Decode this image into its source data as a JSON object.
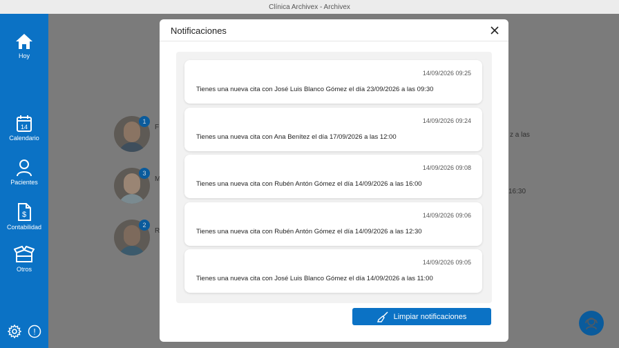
{
  "window": {
    "title": "Clínica Archivex - Archivex"
  },
  "sidebar": {
    "items": [
      {
        "label": "Hoy",
        "icon": "home-icon"
      },
      {
        "label": "Calendario",
        "icon": "calendar-icon",
        "day": "14"
      },
      {
        "label": "Pacientes",
        "icon": "user-icon"
      },
      {
        "label": "Contabilidad",
        "icon": "invoice-icon"
      },
      {
        "label": "Otros",
        "icon": "box-icon"
      }
    ],
    "bottom": [
      {
        "icon": "gear-icon"
      },
      {
        "icon": "info-icon",
        "glyph": "!"
      }
    ]
  },
  "background": {
    "rows": [
      {
        "badge": "1",
        "initial": "F",
        "trailing": "z a las"
      },
      {
        "badge": "3",
        "initial": "M",
        "trailing": "16:30"
      },
      {
        "badge": "2",
        "initial": "R",
        "trailing": ""
      }
    ]
  },
  "modal": {
    "title": "Notificaciones",
    "clear_label": "Limpiar notificaciones",
    "notifications": [
      {
        "date": "14/09/2026 09:25",
        "message": "Tienes una nueva cita con José Luis Blanco Gómez el día 23/09/2026 a las 09:30"
      },
      {
        "date": "14/09/2026 09:24",
        "message": "Tienes una nueva cita con Ana Benítez el día 17/09/2026 a las 12:00"
      },
      {
        "date": "14/09/2026 09:08",
        "message": "Tienes una nueva cita con Rubén Antón Gómez el día 14/09/2026 a las 16:00"
      },
      {
        "date": "14/09/2026 09:06",
        "message": "Tienes una nueva cita con Rubén Antón Gómez el día 14/09/2026 a las 12:30"
      },
      {
        "date": "14/09/2026 09:05",
        "message": "Tienes una nueva cita con José Luis Blanco Gómez el día 14/09/2026 a las 11:00"
      }
    ]
  },
  "colors": {
    "primary": "#0b72c5",
    "overlay": "#7b7b7b",
    "badge": "#0a5b9c"
  }
}
